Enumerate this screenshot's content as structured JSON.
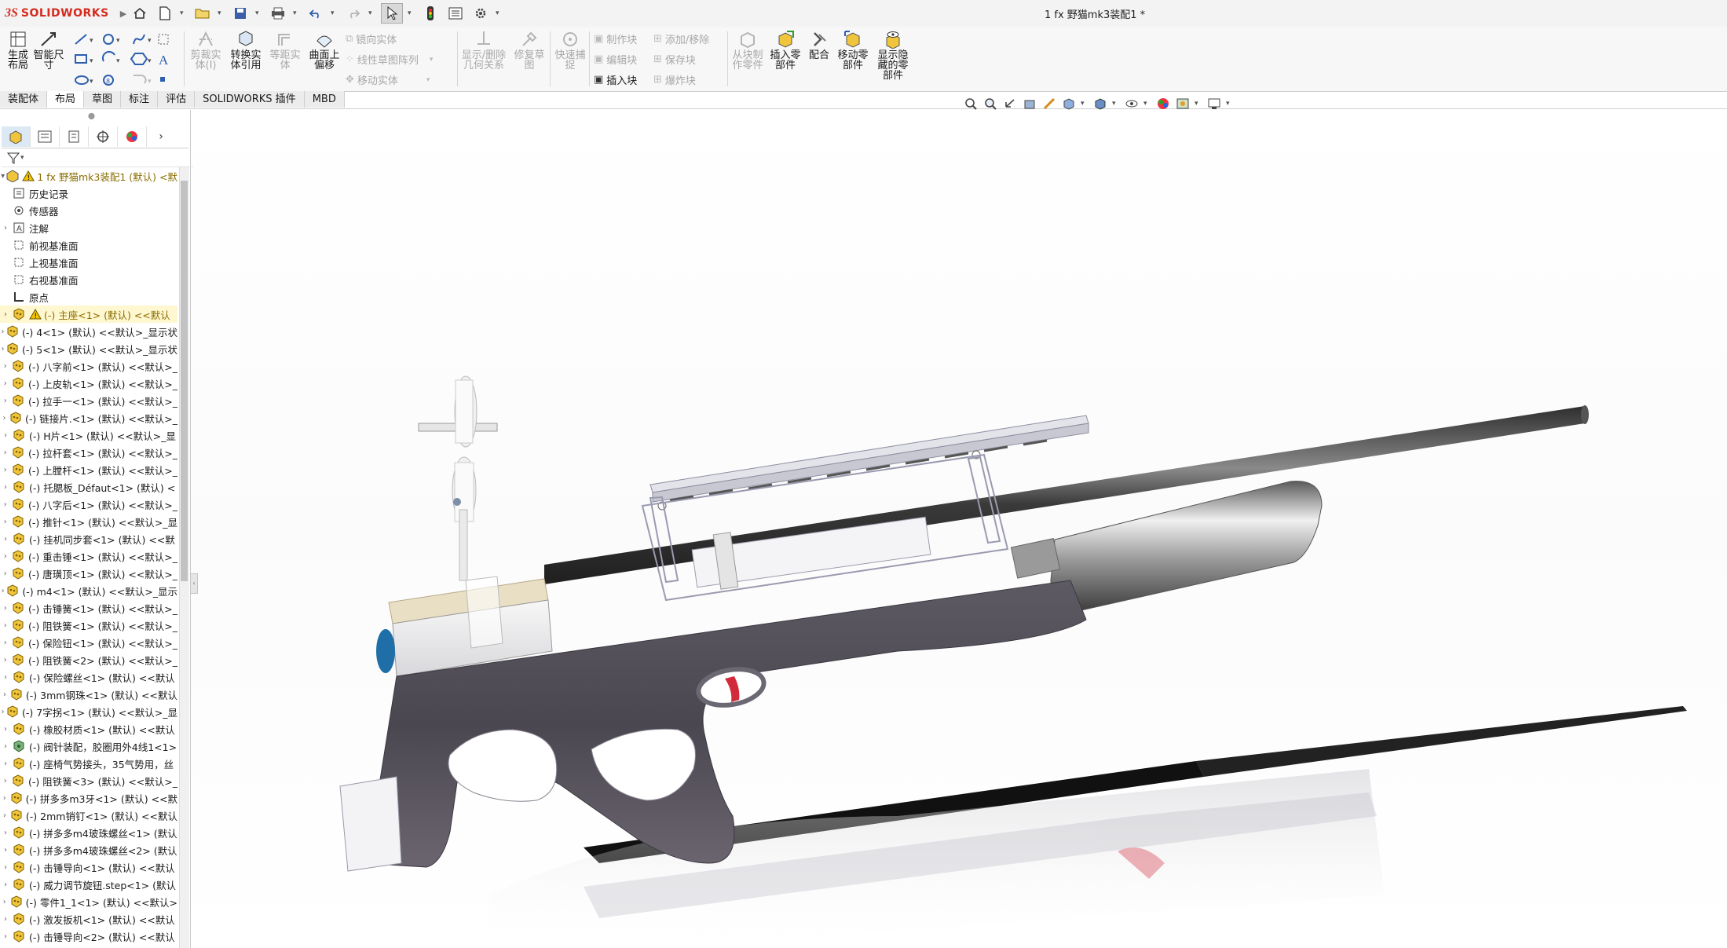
{
  "app": {
    "brand_ds": "3S",
    "brand_name": "SOLIDWORKS",
    "document_title": "1   fx 野猫mk3装配1 *",
    "accent_color": "#d52b1e"
  },
  "ribbon": {
    "big_buttons": [
      {
        "label": "生成\n布局",
        "icon": "layout-icon",
        "enabled": true
      },
      {
        "label": "智能尺\n寸",
        "icon": "smart-dimension-icon",
        "enabled": true
      },
      {
        "label": "剪裁实\n体(I)",
        "icon": "trim-entities-icon",
        "enabled": false
      },
      {
        "label": "转换实\n体引用",
        "icon": "convert-entities-icon",
        "enabled": true
      },
      {
        "label": "等距实\n体",
        "icon": "offset-entities-icon",
        "enabled": false
      },
      {
        "label": "曲面上\n偏移",
        "icon": "offset-on-surface-icon",
        "enabled": true
      },
      {
        "label": "显示/删除\n几何关系",
        "icon": "relations-icon",
        "enabled": false
      },
      {
        "label": "修复草\n图",
        "icon": "repair-sketch-icon",
        "enabled": false
      },
      {
        "label": "快速捕\n捉",
        "icon": "quick-snaps-icon",
        "enabled": false
      },
      {
        "label": "从块制\n作零件",
        "icon": "make-part-from-block-icon",
        "enabled": false
      },
      {
        "label": "插入零\n部件",
        "icon": "insert-component-icon",
        "enabled": true
      },
      {
        "label": "配合",
        "icon": "mate-icon",
        "enabled": true
      },
      {
        "label": "移动零\n部件",
        "icon": "move-component-icon",
        "enabled": true
      },
      {
        "label": "显示隐\n藏的零\n部件",
        "icon": "show-hidden-components-icon",
        "enabled": true
      }
    ],
    "small_buttons": [
      {
        "label": "镜向实体",
        "enabled": false
      },
      {
        "label": "线性草图阵列",
        "enabled": false
      },
      {
        "label": "移动实体",
        "enabled": false
      },
      {
        "label": "制作块",
        "enabled": false
      },
      {
        "label": "编辑块",
        "enabled": false
      },
      {
        "label": "插入块",
        "enabled": true
      },
      {
        "label": "添加/移除",
        "enabled": false
      },
      {
        "label": "保存块",
        "enabled": false
      },
      {
        "label": "爆炸块",
        "enabled": false
      }
    ]
  },
  "tabs": [
    "装配体",
    "布局",
    "草图",
    "标注",
    "评估",
    "SOLIDWORKS 插件",
    "MBD"
  ],
  "active_tab": "布局",
  "tree": {
    "root": "1    fx 野猫mk3装配1 (默认) <默",
    "items": [
      {
        "label": "历史记录",
        "icon": "history-icon",
        "expand": false
      },
      {
        "label": "传感器",
        "icon": "sensor-icon",
        "expand": false
      },
      {
        "label": "注解",
        "icon": "annotation-icon",
        "expand": true
      },
      {
        "label": "前视基准面",
        "icon": "plane-icon",
        "expand": false
      },
      {
        "label": "上视基准面",
        "icon": "plane-icon",
        "expand": false
      },
      {
        "label": "右视基准面",
        "icon": "plane-icon",
        "expand": false
      },
      {
        "label": "原点",
        "icon": "origin-icon",
        "expand": false
      },
      {
        "label": "(-) 主座<1> (默认) <<默认",
        "icon": "part-icon",
        "expand": true,
        "warning": true,
        "selected": true
      },
      {
        "label": "(-) 4<1> (默认) <<默认>_显示状",
        "icon": "part-icon",
        "expand": true
      },
      {
        "label": "(-) 5<1> (默认) <<默认>_显示状",
        "icon": "part-icon",
        "expand": true
      },
      {
        "label": "(-) 八字前<1> (默认) <<默认>_",
        "icon": "part-icon",
        "expand": true
      },
      {
        "label": "(-) 上皮轨<1> (默认) <<默认>_",
        "icon": "part-icon",
        "expand": true
      },
      {
        "label": "(-) 拉手一<1> (默认) <<默认>_",
        "icon": "part-icon",
        "expand": true
      },
      {
        "label": "(-) 链接片.<1> (默认) <<默认>_",
        "icon": "part-icon",
        "expand": true
      },
      {
        "label": "(-) H片<1> (默认) <<默认>_显",
        "icon": "part-icon",
        "expand": true
      },
      {
        "label": "(-) 拉杆套<1> (默认) <<默认>_",
        "icon": "part-icon",
        "expand": true
      },
      {
        "label": "(-) 上膛杆<1> (默认) <<默认>_",
        "icon": "part-icon",
        "expand": true
      },
      {
        "label": "(-) 托腮板_Défaut<1> (默认) <",
        "icon": "part-icon",
        "expand": true
      },
      {
        "label": "(-) 八字后<1> (默认) <<默认>_",
        "icon": "part-icon",
        "expand": true
      },
      {
        "label": "(-) 推针<1> (默认) <<默认>_显",
        "icon": "part-icon",
        "expand": true
      },
      {
        "label": "(-) 挂机同步套<1> (默认) <<默",
        "icon": "part-icon",
        "expand": true
      },
      {
        "label": "(-) 重击锤<1> (默认) <<默认>_",
        "icon": "part-icon",
        "expand": true
      },
      {
        "label": "(-) 唐璜顶<1> (默认) <<默认>_",
        "icon": "part-icon",
        "expand": true
      },
      {
        "label": "(-) m4<1> (默认) <<默认>_显示",
        "icon": "part-icon",
        "expand": true
      },
      {
        "label": "(-) 击锤簧<1> (默认) <<默认>_",
        "icon": "part-icon",
        "expand": true
      },
      {
        "label": "(-) 阻铁簧<1> (默认) <<默认>_",
        "icon": "part-icon",
        "expand": true
      },
      {
        "label": "(-) 保险钮<1> (默认) <<默认>_",
        "icon": "part-icon",
        "expand": true
      },
      {
        "label": "(-) 阻铁簧<2> (默认) <<默认>_",
        "icon": "part-icon",
        "expand": true
      },
      {
        "label": "(-) 保险螺丝<1> (默认) <<默认",
        "icon": "part-icon",
        "expand": true
      },
      {
        "label": "(-) 3mm钢珠<1> (默认) <<默认",
        "icon": "part-icon",
        "expand": true
      },
      {
        "label": "(-) 7字拐<1> (默认) <<默认>_显",
        "icon": "part-icon",
        "expand": true
      },
      {
        "label": "(-) 橡胶材质<1> (默认) <<默认",
        "icon": "part-icon",
        "expand": true
      },
      {
        "label": "(-) 阀针装配，胶圈用外4线1<1>",
        "icon": "assembly-icon",
        "expand": true
      },
      {
        "label": "(-) 座椅气势接头，35气势用，丝",
        "icon": "part-icon",
        "expand": true
      },
      {
        "label": "(-) 阻铁簧<3> (默认) <<默认>_",
        "icon": "part-icon",
        "expand": true
      },
      {
        "label": "(-) 拼多多m3牙<1> (默认) <<默",
        "icon": "part-icon",
        "expand": true
      },
      {
        "label": "(-) 2mm销钉<1> (默认) <<默认",
        "icon": "part-icon",
        "expand": true
      },
      {
        "label": "(-) 拼多多m4玻珠螺丝<1> (默认",
        "icon": "part-icon",
        "expand": true
      },
      {
        "label": "(-) 拼多多m4玻珠螺丝<2> (默认",
        "icon": "part-icon",
        "expand": true
      },
      {
        "label": "(-) 击锤导向<1> (默认) <<默认",
        "icon": "part-icon",
        "expand": true
      },
      {
        "label": "(-) 威力调节旋钮.step<1> (默认",
        "icon": "part-icon",
        "expand": true
      },
      {
        "label": "(-) 零件1_1<1> (默认) <<默认>",
        "icon": "part-icon",
        "expand": true
      },
      {
        "label": "(-) 激发扳机<1> (默认) <<默认",
        "icon": "part-icon",
        "expand": true
      },
      {
        "label": "(-) 击锤导向<2> (默认) <<默认",
        "icon": "part-icon",
        "expand": true
      }
    ]
  },
  "colors": {
    "part_icon": "#e8b100",
    "warning": "#f2c200",
    "stock": "#55525a",
    "barrel": "#4b4b4b",
    "selected_row": "#fff7cf"
  }
}
